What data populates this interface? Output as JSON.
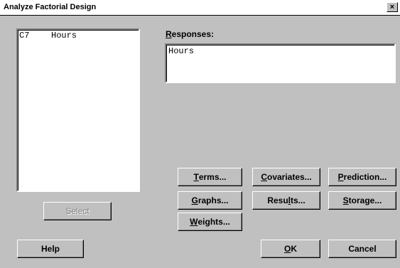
{
  "window": {
    "title": "Analyze Factorial Design",
    "close_label": "×"
  },
  "variables": {
    "items": [
      {
        "column": "C7",
        "name": "Hours"
      }
    ]
  },
  "responses": {
    "label_mnemonic": "R",
    "label_rest": "esponses:",
    "value": "Hours"
  },
  "buttons": {
    "terms": {
      "pre": "",
      "mn": "T",
      "post": "erms..."
    },
    "covariates": {
      "pre": "",
      "mn": "C",
      "post": "ovariates..."
    },
    "prediction": {
      "pre": "",
      "mn": "P",
      "post": "rediction..."
    },
    "graphs": {
      "pre": "",
      "mn": "G",
      "post": "raphs..."
    },
    "results": {
      "pre": "Resu",
      "mn": "l",
      "post": "ts..."
    },
    "storage": {
      "pre": "",
      "mn": "S",
      "post": "torage..."
    },
    "weights": {
      "pre": "",
      "mn": "W",
      "post": "eights..."
    },
    "select": "Select",
    "help": "Help",
    "ok": {
      "pre": "",
      "mn": "O",
      "post": "K"
    },
    "cancel": "Cancel"
  }
}
